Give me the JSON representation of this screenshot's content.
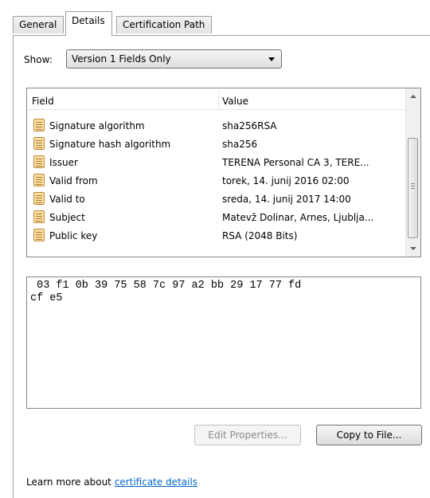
{
  "tabs": [
    {
      "label": "General"
    },
    {
      "label": "Details",
      "active": true
    },
    {
      "label": "Certification Path"
    }
  ],
  "show": {
    "label": "Show:",
    "selected": "Version 1 Fields Only"
  },
  "fields_list": {
    "headers": {
      "field": "Field",
      "value": "Value"
    },
    "rows": [
      {
        "field": "Signature algorithm",
        "value": "sha256RSA",
        "icon": "certificate-field-icon"
      },
      {
        "field": "Signature hash algorithm",
        "value": "sha256",
        "icon": "certificate-field-icon"
      },
      {
        "field": "Issuer",
        "value": "TERENA Personal CA 3, TERE...",
        "icon": "certificate-field-icon"
      },
      {
        "field": "Valid from",
        "value": "torek, 14. junij 2016 02:00",
        "icon": "certificate-field-icon"
      },
      {
        "field": "Valid to",
        "value": "sreda, 14. junij 2017 14:00",
        "icon": "certificate-field-icon"
      },
      {
        "field": "Subject",
        "value": "Matevž Dolinar, Arnes, Ljublja...",
        "icon": "certificate-field-icon"
      },
      {
        "field": "Public key",
        "value": "RSA (2048 Bits)",
        "icon": "certificate-field-icon"
      }
    ]
  },
  "detail_value": " 03 f1 0b 39 75 58 7c 97 a2 bb 29 17 77 fd\ncf e5",
  "buttons": {
    "edit_properties": "Edit Properties...",
    "copy_to_file": "Copy to File..."
  },
  "footer": {
    "text": "Learn more about ",
    "link": "certificate details"
  },
  "colors": {
    "link": "#0066cc",
    "icon_fill": "#f9dfa5",
    "icon_border": "#c28a37"
  }
}
